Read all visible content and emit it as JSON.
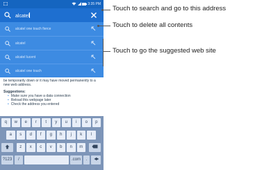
{
  "status_bar": {
    "time": "3:35 PM"
  },
  "search": {
    "query": "alcatel"
  },
  "suggestions": [
    {
      "label": "alcatel one touch fierce"
    },
    {
      "label": "alcatel"
    },
    {
      "label": "alcatel lucent"
    },
    {
      "label": "alcatel one touch"
    }
  ],
  "page_body": {
    "error_text": "be temporarily down or it may have moved permanently to a new web address.",
    "suggestions_heading": "Suggestions:",
    "tips": [
      "Make sure you have a data connection",
      "Reload this webpage later",
      "Check the address you entered"
    ]
  },
  "keyboard": {
    "row1": [
      "q",
      "w",
      "e",
      "r",
      "t",
      "y",
      "u",
      "i",
      "o",
      "p"
    ],
    "row2": [
      "a",
      "s",
      "d",
      "f",
      "g",
      "h",
      "j",
      "k",
      "l"
    ],
    "row3": [
      "z",
      "x",
      "c",
      "v",
      "b",
      "n",
      "m"
    ],
    "symbols_label": "?123",
    "slash_label": "/",
    "dotcom_label": ".com",
    "period_label": "."
  },
  "callouts": {
    "search": "Touch to search and go to this address",
    "delete": "Touch to delete all contents",
    "suggested": "Touch to go the suggested web site"
  },
  "colors": {
    "search_bar": "#1e6fd0",
    "suggestions_bg": "#3d8be2",
    "keyboard_bg": "#7d95b8"
  }
}
